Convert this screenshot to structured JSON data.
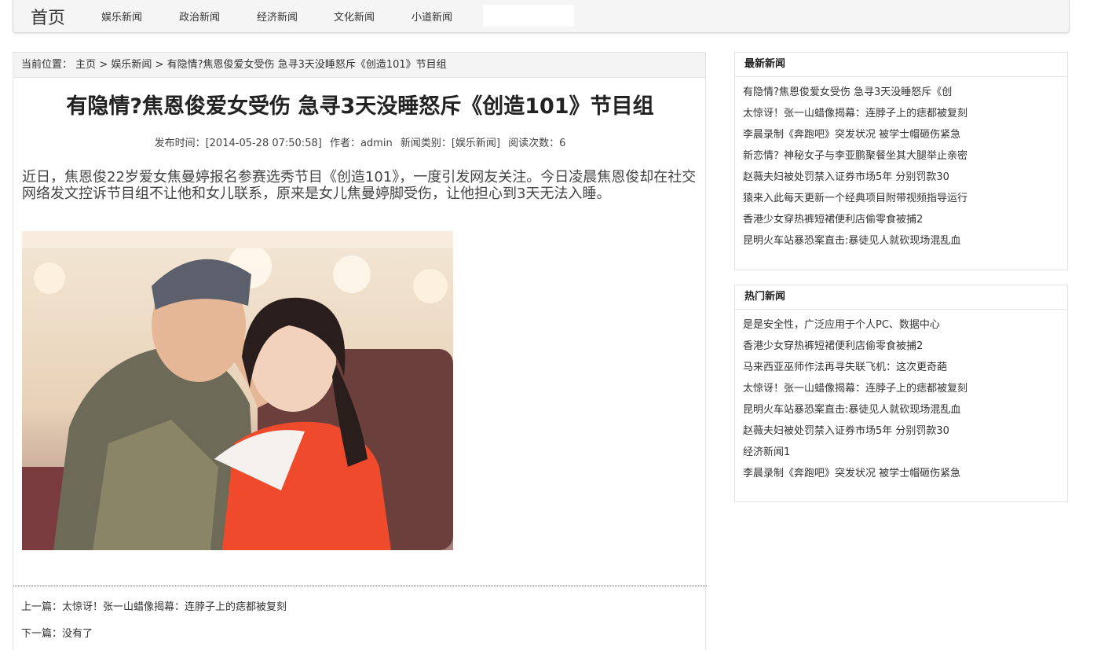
{
  "nav": {
    "home": "首页",
    "links": [
      "娱乐新闻",
      "政治新闻",
      "经济新闻",
      "文化新闻",
      "小道新闻"
    ],
    "search_value": ""
  },
  "breadcrumb": {
    "label": "当前位置：",
    "home": "主页",
    "sep": ">",
    "category": "娱乐新闻",
    "current": "有隐情?焦恩俊爱女受伤 急寻3天没睡怒斥《创造101》节目组"
  },
  "article": {
    "title": "有隐情?焦恩俊爱女受伤 急寻3天没睡怒斥《创造101》节目组",
    "meta": {
      "published": "发布时间：[2014-05-28 07:50:58]",
      "author": "作者：admin",
      "category": "新闻类别：[娱乐新闻]",
      "views": "阅读次数：6"
    },
    "body": "近日，焦恩俊22岁爱女焦曼婷报名参赛选秀节目《创造101》，一度引发网友关注。今日凌晨焦恩俊却在社交网络发文控诉节目组不让他和女儿联系，原来是女儿焦曼婷脚受伤，让他担心到3天无法入睡。"
  },
  "pager": {
    "prev": "上一篇：太惊讶！张一山蜡像揭幕：连脖子上的痣都被复刻",
    "next": "下一篇：没有了"
  },
  "latest": {
    "title": "最新新闻",
    "items": [
      "有隐情?焦恩俊爱女受伤 急寻3天没睡怒斥《创",
      "太惊讶！张一山蜡像揭幕：连脖子上的痣都被复刻",
      "李晨录制《奔跑吧》突发状况 被学士帽砸伤紧急",
      "新恋情？神秘女子与李亚鹏聚餐坐其大腿举止亲密",
      "赵薇夫妇被处罚禁入证券市场5年 分别罚款30",
      "猿来入此每天更新一个经典项目附带视频指导运行",
      "香港少女穿热裤短裙便利店偷零食被捕2",
      "昆明火车站暴恐案直击:暴徒见人就砍现场混乱血"
    ]
  },
  "hot": {
    "title": "热门新闻",
    "items": [
      "是是安全性，广泛应用于个人PC、数据中心",
      "香港少女穿热裤短裙便利店偷零食被捕2",
      "马来西亚巫师作法再寻失联飞机：这次更奇葩",
      "太惊讶！张一山蜡像揭幕：连脖子上的痣都被复刻",
      "昆明火车站暴恐案直击:暴徒见人就砍现场混乱血",
      "赵薇夫妇被处罚禁入证券市场5年 分别罚款30",
      "经济新闻1",
      "李晨录制《奔跑吧》突发状况 被学士帽砸伤紧急"
    ]
  }
}
